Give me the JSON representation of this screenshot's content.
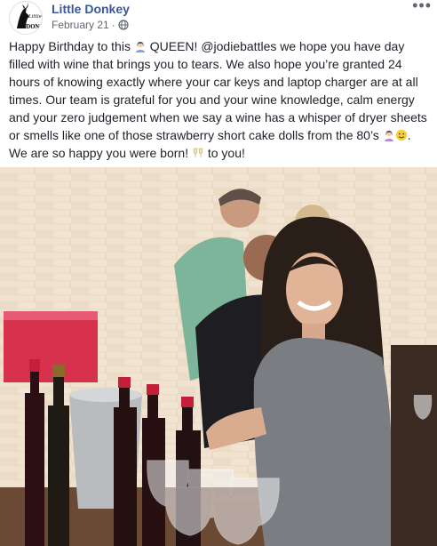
{
  "post": {
    "author": "Little Donkey",
    "date": "February 21",
    "privacy_icon": "globe-icon",
    "more_icon": "more-options-icon",
    "avatar_logo": "Little\nDONKEY",
    "text_segments": [
      "Happy Birthday to this ",
      " QUEEN! @jodiebattles we hope you have day filled with wine that brings you to tears. We also hope you’re granted 24 hours of knowing exactly where your car keys and laptop charger are at all times. Our team is grateful for you and your wine knowledge, calm energy and your zero judgement when we say a wine has a whisper of dryer sheets or smells like one of those strawberry short cake dolls from the 80’s ",
      ". We are so happy you were born! ",
      " to you!"
    ],
    "emojis": [
      "woman-tipping-hand-emoji",
      "woman-tipping-hand-emoji",
      "smiling-face-emoji",
      "clinking-glasses-emoji"
    ]
  },
  "colors": {
    "author_link": "#385898",
    "meta_gray": "#616770",
    "text": "#1d2129"
  }
}
